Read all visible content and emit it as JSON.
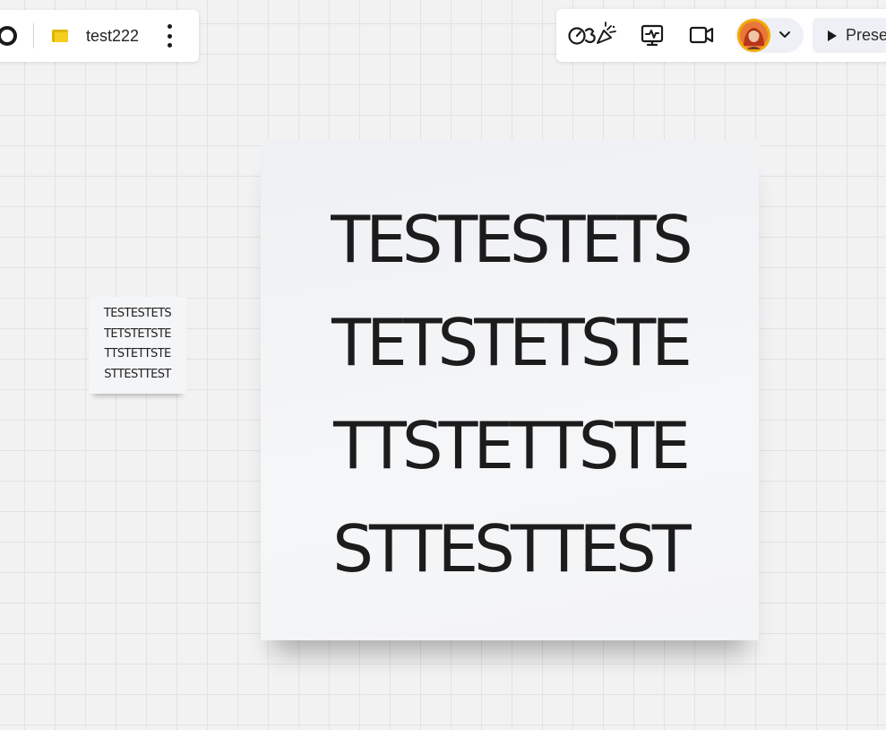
{
  "board": {
    "name": "test222"
  },
  "toolbar": {
    "timer_icon": "timer-confetti-icon",
    "activity_icon": "activity-board-icon",
    "video_icon": "video-camera-icon",
    "avatar_icon": "user-avatar",
    "chevron_icon": "chevron-down-icon",
    "present_label": "Present"
  },
  "stickies": {
    "small": {
      "lines": [
        "TESTESTETS",
        "TETSTETSTE",
        "TTSTETTSTE",
        "STTESTTEST"
      ]
    },
    "large": {
      "lines": [
        "TESTESTETS",
        "TETSTETSTE",
        "TTSTETTSTE",
        "STTESTTEST"
      ]
    }
  },
  "colors": {
    "canvas": "#f2f2f2",
    "grid": "#e2e2e2",
    "panel": "#ffffff",
    "sticky": "#f4f5f7",
    "text": "#1c1c1c",
    "folder": "#f5cf1f",
    "avatar_ring": "#f2a900"
  }
}
